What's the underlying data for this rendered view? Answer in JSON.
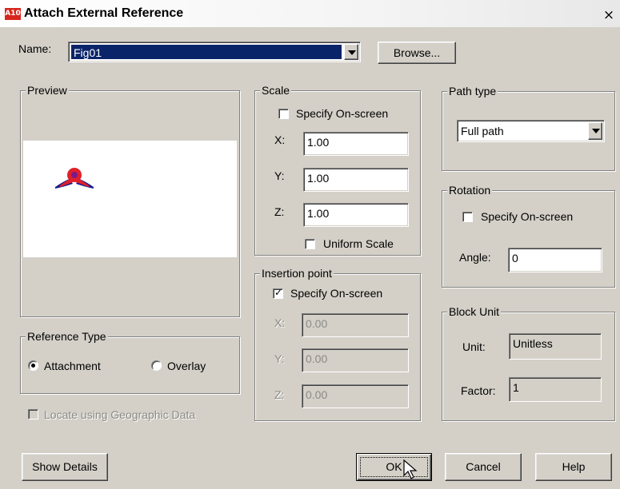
{
  "window": {
    "title": "Attach External Reference",
    "close_label": "×",
    "app_icon_text": "A10"
  },
  "name": {
    "label": "Name:",
    "value": "Fig01",
    "browse_label": "Browse..."
  },
  "preview": {
    "title": "Preview"
  },
  "reference_type": {
    "title": "Reference Type",
    "attachment_label": "Attachment",
    "overlay_label": "Overlay",
    "selected": "Attachment"
  },
  "geo": {
    "label": "Locate using Geographic Data"
  },
  "scale": {
    "title": "Scale",
    "specify_label": "Specify On-screen",
    "x_label": "X:",
    "x_value": "1.00",
    "y_label": "Y:",
    "y_value": "1.00",
    "z_label": "Z:",
    "z_value": "1.00",
    "uniform_label": "Uniform Scale"
  },
  "insertion": {
    "title": "Insertion point",
    "specify_label": "Specify On-screen",
    "x_label": "X:",
    "x_value": "0.00",
    "y_label": "Y:",
    "y_value": "0.00",
    "z_label": "Z:",
    "z_value": "0.00"
  },
  "path_type": {
    "title": "Path type",
    "value": "Full path"
  },
  "rotation": {
    "title": "Rotation",
    "specify_label": "Specify On-screen",
    "angle_label": "Angle:",
    "angle_value": "0"
  },
  "block_unit": {
    "title": "Block Unit",
    "unit_label": "Unit:",
    "unit_value": "Unitless",
    "factor_label": "Factor:",
    "factor_value": "1"
  },
  "buttons": {
    "show_details": "Show Details",
    "ok": "OK",
    "cancel": "Cancel",
    "help": "Help"
  },
  "colors": {
    "title_bar": "#ffffff",
    "selection": "#0a246a",
    "dialog": "#d4d0c8",
    "preview_red": "#e0202a",
    "preview_navy": "#1c1c8a"
  }
}
